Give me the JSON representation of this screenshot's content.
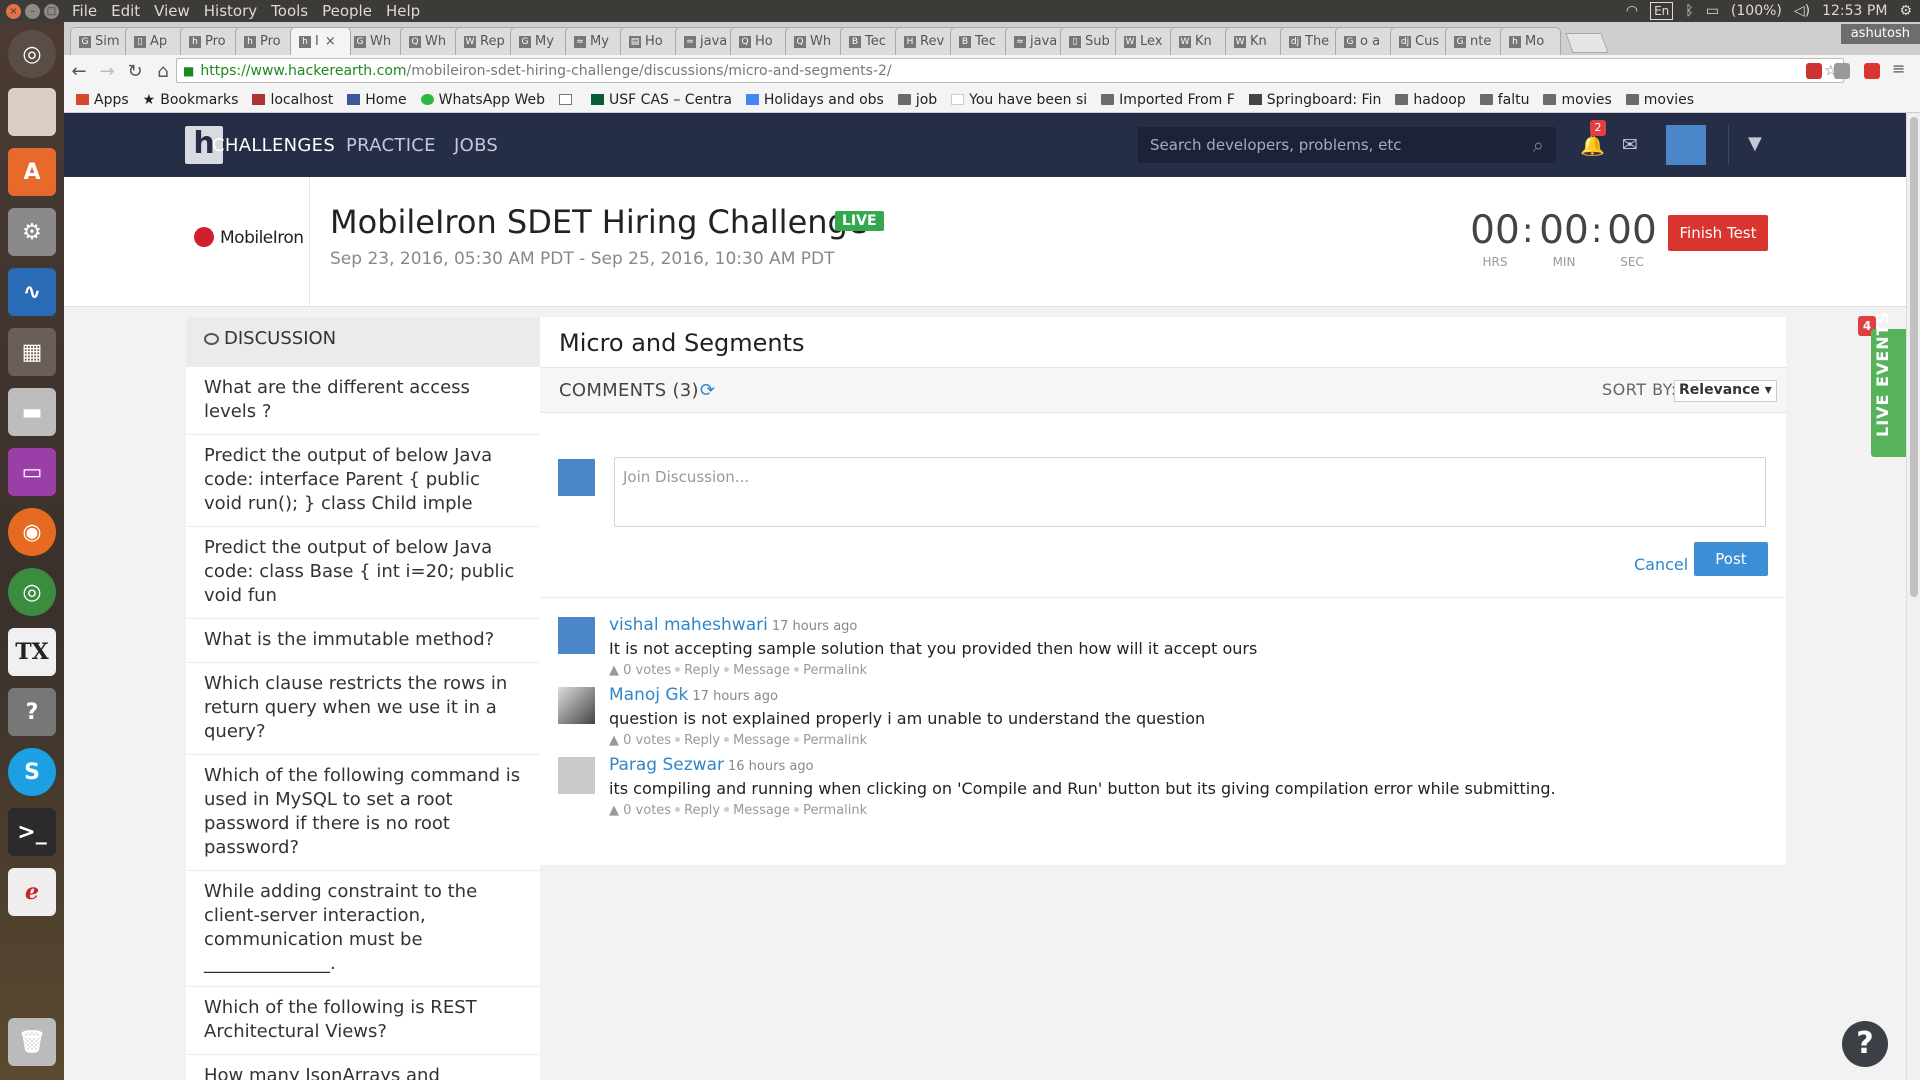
{
  "system": {
    "menus": [
      "File",
      "Edit",
      "View",
      "History",
      "Tools",
      "People",
      "Help"
    ],
    "lang": "En",
    "battery": "(100%)",
    "clock": "12:53 PM"
  },
  "browser": {
    "user": "ashutosh",
    "tabs": [
      {
        "fav": "G",
        "label": "Sim"
      },
      {
        "fav": "▯",
        "label": "Ap"
      },
      {
        "fav": "h",
        "label": "Pro"
      },
      {
        "fav": "h",
        "label": "Pro"
      },
      {
        "fav": "h",
        "label": "I"
      },
      {
        "fav": "G",
        "label": "Wh"
      },
      {
        "fav": "Q",
        "label": "Wh"
      },
      {
        "fav": "W",
        "label": "Rep"
      },
      {
        "fav": "G",
        "label": "My"
      },
      {
        "fav": "≈",
        "label": "My"
      },
      {
        "fav": "▤",
        "label": "Ho"
      },
      {
        "fav": "≈",
        "label": "java"
      },
      {
        "fav": "Q",
        "label": "Ho"
      },
      {
        "fav": "Q",
        "label": "Wh"
      },
      {
        "fav": "B",
        "label": "Tec"
      },
      {
        "fav": "H",
        "label": "Rev"
      },
      {
        "fav": "B",
        "label": "Tec"
      },
      {
        "fav": "≈",
        "label": "java"
      },
      {
        "fav": "▯",
        "label": "Sub"
      },
      {
        "fav": "W",
        "label": "Lex"
      },
      {
        "fav": "W",
        "label": "Kn"
      },
      {
        "fav": "W",
        "label": "Kn"
      },
      {
        "fav": "dj",
        "label": "The"
      },
      {
        "fav": "G",
        "label": "o a"
      },
      {
        "fav": "dj",
        "label": "Cus"
      },
      {
        "fav": "G",
        "label": "nte"
      },
      {
        "fav": "h",
        "label": "Mo"
      }
    ],
    "url_host": "https://www.hackerearth.com",
    "url_path": "/mobileiron-sdet-hiring-challenge/discussions/micro-and-segments-2/",
    "bookmarks": [
      {
        "label": "Apps"
      },
      {
        "label": "Bookmarks"
      },
      {
        "label": "localhost"
      },
      {
        "label": "Home"
      },
      {
        "label": "WhatsApp Web"
      },
      {
        "label": ""
      },
      {
        "label": "USF CAS – Centra"
      },
      {
        "label": "Holidays and obs"
      },
      {
        "label": "job"
      },
      {
        "label": "You have been si"
      },
      {
        "label": "Imported From F"
      },
      {
        "label": "Springboard: Fin"
      },
      {
        "label": "hadoop"
      },
      {
        "label": "faltu"
      },
      {
        "label": "movies"
      },
      {
        "label": "movies"
      }
    ]
  },
  "nav": {
    "links": [
      "CHALLENGES",
      "PRACTICE",
      "JOBS"
    ],
    "search_placeholder": "Search developers, problems, etc",
    "notifications": "2"
  },
  "challenge": {
    "company": "MobileIron",
    "title": "MobileIron SDET Hiring Challenge",
    "status": "LIVE",
    "dates": "Sep 23, 2016, 05:30 AM PDT - Sep 25, 2016, 10:30 AM PDT",
    "timer": {
      "hrs": "00",
      "min": "00",
      "sec": "00",
      "hrs_label": "HRS",
      "min_label": "MIN",
      "sec_label": "SEC"
    },
    "finish_label": "Finish Test"
  },
  "live_events": {
    "label": "LIVE EVENTS",
    "count": "4"
  },
  "sidebar": {
    "heading": "DISCUSSION",
    "items": [
      "What are the different access levels ?",
      "Predict the output of below Java code: interface Parent { public void run(); } class Child imple",
      "Predict the output of below Java code: class Base { int i=20; public void fun",
      "What is the immutable method?",
      "Which clause restricts the rows in return query when we use it in a query?",
      "Which of the following command is used in MySQL to set a root password if there is no root password?",
      "While adding constraint to the client-server interaction, communication must be ______________.",
      "Which of the following is REST Architectural Views?",
      "How many JsonArrays and JsonObjects are there in the below"
    ]
  },
  "discussion": {
    "title": "Micro and Segments",
    "comments_label": "COMMENTS (3)",
    "sort_label": "SORT BY:",
    "sort_value": "Relevance",
    "composer_placeholder": "Join Discussion...",
    "cancel_label": "Cancel",
    "post_label": "Post",
    "comments": [
      {
        "author": "vishal maheshwari",
        "time": "17 hours ago",
        "text": "It is not accepting sample solution that you provided then how will it accept ours",
        "votes": "0 votes",
        "reply": "Reply",
        "message": "Message",
        "permalink": "Permalink"
      },
      {
        "author": "Manoj Gk",
        "time": "17 hours ago",
        "text": "question is not explained properly i am unable to understand the question",
        "votes": "0 votes",
        "reply": "Reply",
        "message": "Message",
        "permalink": "Permalink"
      },
      {
        "author": "Parag Sezwar",
        "time": "16 hours ago",
        "text": "its compiling and running when clicking on 'Compile and Run' button but its giving compilation error while submitting.",
        "votes": "0 votes",
        "reply": "Reply",
        "message": "Message",
        "permalink": "Permalink"
      }
    ]
  },
  "help": "?"
}
